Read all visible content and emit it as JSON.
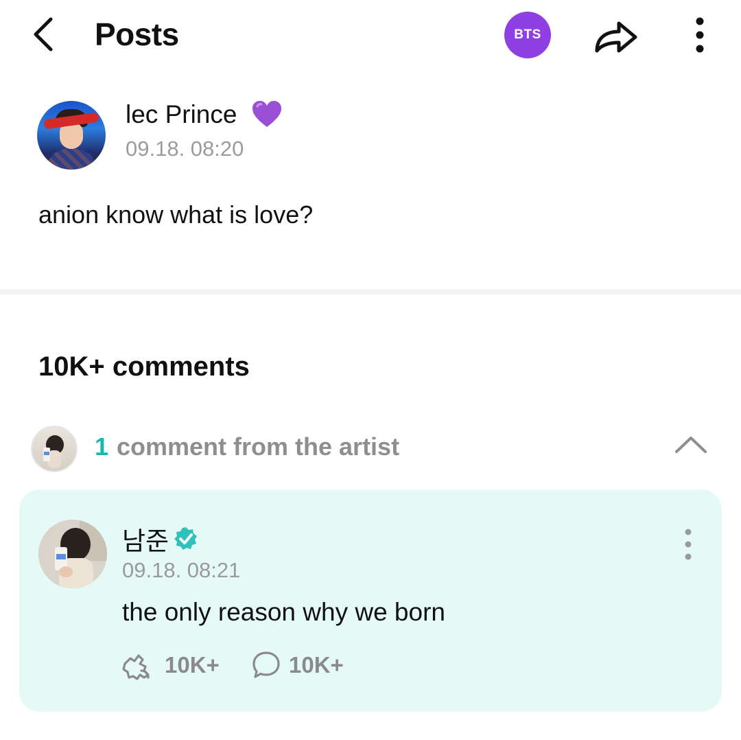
{
  "header": {
    "back_icon": "chevron-left-icon",
    "title": "Posts",
    "community_badge": "BTS",
    "community_badge_color": "#8f3fe3",
    "share_icon": "share-arrow-icon",
    "more_icon": "vertical-dots-icon"
  },
  "post": {
    "author": "lec Prince",
    "author_emoji": "purple-heart-icon",
    "timestamp": "09.18. 08:20",
    "body": "anion know what is love?"
  },
  "comments": {
    "count_label": "10K+ comments",
    "artist_section": {
      "count": "1",
      "label": "comment from the artist",
      "accent_color": "#18b7b0",
      "toggle_icon": "chevron-up-icon"
    },
    "artist_comment": {
      "author": "남준",
      "verified_icon": "verified-badge-icon",
      "timestamp": "09.18. 08:21",
      "text": "the only reason why we born",
      "like_count": "10K+",
      "reply_count": "10K+",
      "card_background": "#e5faf6"
    }
  }
}
